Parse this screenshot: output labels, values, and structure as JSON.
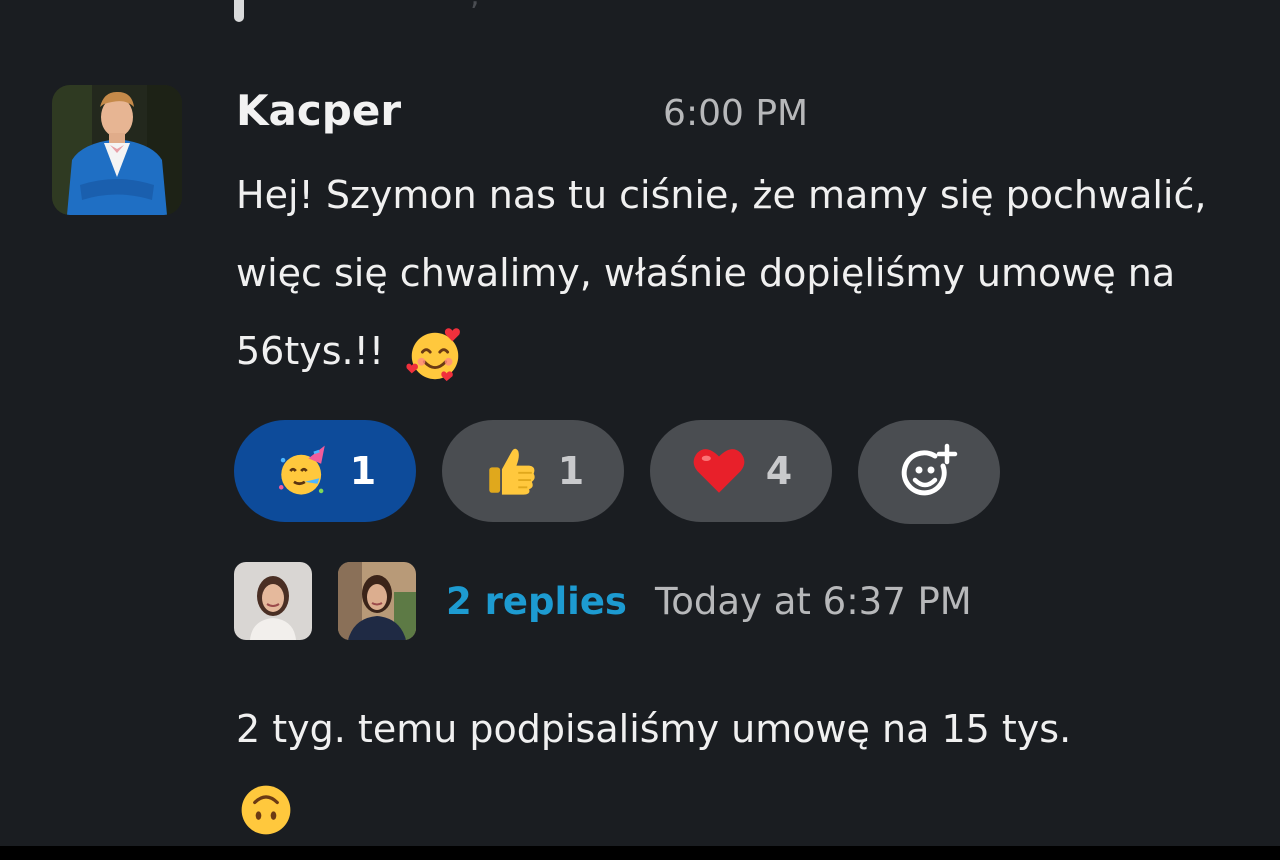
{
  "previous_message": {
    "fragment_text": ", "
  },
  "message": {
    "author": "Kacper",
    "time": "6:00 PM",
    "text": "Hej! Szymon nas tu ciśnie, że mamy się pochwalić, więc się chwalimy, właśnie dopięliśmy umowę na 56tys.!!",
    "inline_emoji": "smiling-face-with-hearts-icon"
  },
  "reactions": [
    {
      "emoji": "partying-face-icon",
      "count": "1",
      "selected": true,
      "color": "#0d4b9a"
    },
    {
      "emoji": "thumbs-up-icon",
      "count": "1",
      "selected": false,
      "color": "#4a4d51"
    },
    {
      "emoji": "red-heart-icon",
      "count": "4",
      "selected": false,
      "color": "#4a4d51"
    }
  ],
  "add_reaction": {
    "icon": "add-emoji-icon"
  },
  "thread": {
    "avatars": [
      "reply-avatar-woman-1",
      "reply-avatar-woman-2"
    ],
    "replies_label": "2 replies",
    "last_reply": "Today at 6:37 PM"
  },
  "second_message": {
    "text": "2 tyg. temu podpisaliśmy umowę na 15 tys.",
    "inline_emoji": "upside-down-face-icon"
  },
  "colors": {
    "background": "#1a1d21",
    "link": "#1d9bd1",
    "selected_reaction": "#0d4b9a"
  }
}
